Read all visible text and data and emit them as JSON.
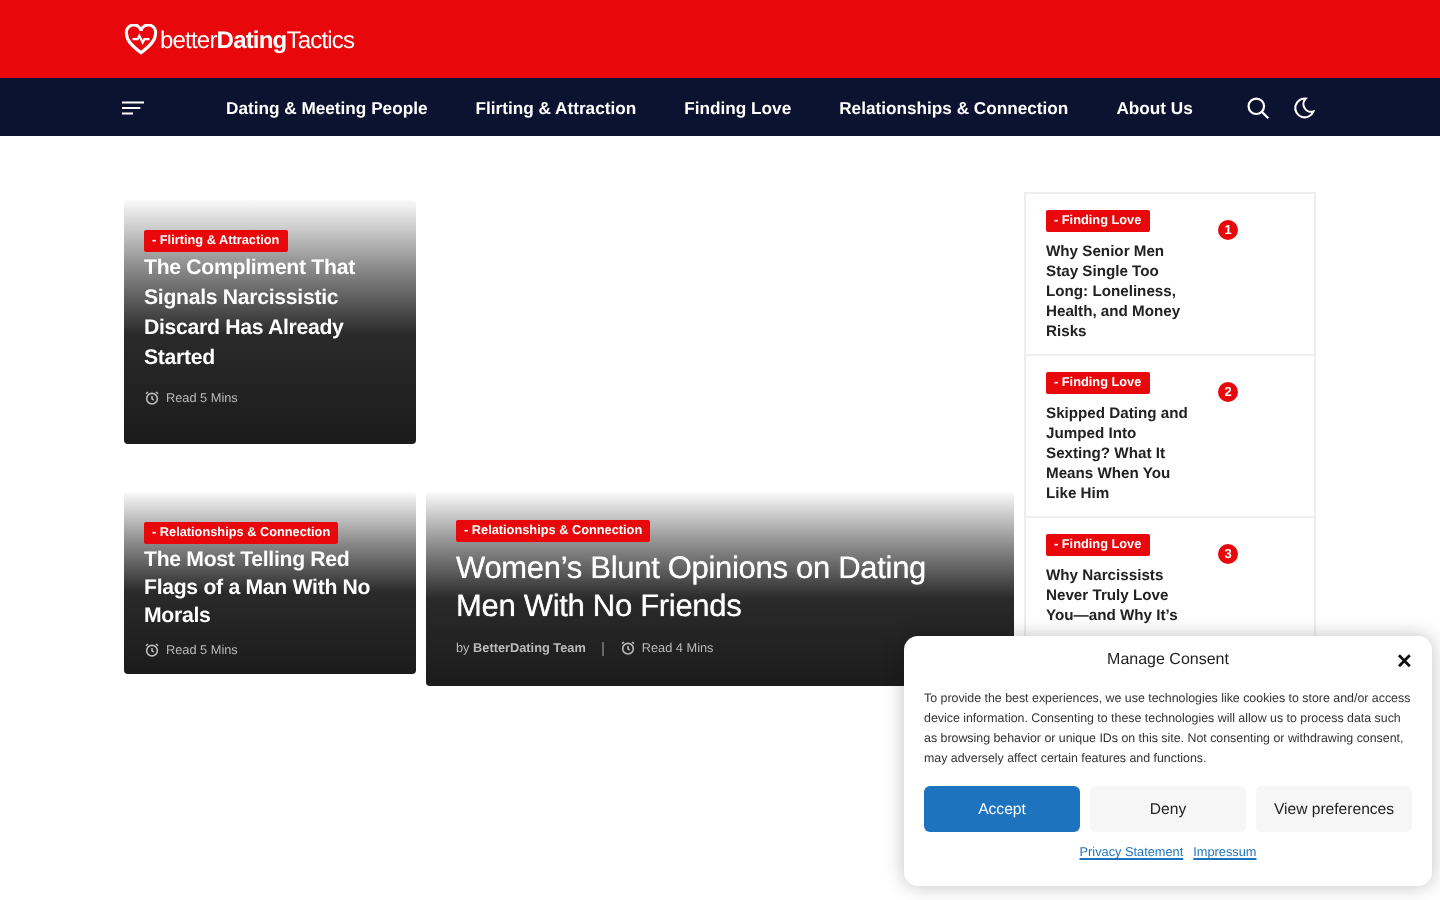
{
  "header": {
    "logo": "better**Dating**Tactics"
  },
  "nav": {
    "items": [
      {
        "label": "Dating & Meeting People"
      },
      {
        "label": "Flirting & Attraction"
      },
      {
        "label": "Finding Love"
      },
      {
        "label": "Relationships & Connection"
      },
      {
        "label": "About Us"
      }
    ]
  },
  "posts": [
    {
      "kind": "small",
      "category": "- Flirting & Attraction",
      "title": "The Compliment That Signals Narcissistic Discard Has Already Started",
      "read_time": "Read 5 Mins"
    },
    {
      "kind": "small",
      "category": "- Relationships & Connection",
      "title": "The Most Telling Red Flags of a Man With No Morals",
      "read_time": "Read 5 Mins"
    },
    {
      "kind": "large",
      "category": "- Relationships & Connection",
      "title": "Women’s Blunt Opinions on Dating Men With No Friends",
      "byline": "by **BetterDating Team**",
      "read_time": "Read 4 Mins"
    }
  ],
  "sidebar": {
    "items": [
      {
        "category": "- Finding Love",
        "title": "Why Senior Men Stay Single Too Long: Loneliness, Health, and Money Risks",
        "rank": "1"
      },
      {
        "category": "- Finding Love",
        "title": "Skipped Dating and Jumped Into Sexting? What It Means When You Like Him",
        "rank": "2"
      },
      {
        "category": "- Finding Love",
        "title": "Why Narcissists Never Truly Love You—and Why It’s",
        "rank": "3"
      }
    ]
  },
  "consent": {
    "title": "Manage Consent",
    "close": "✕",
    "text": "To provide the best experiences, we use technologies like cookies to store and/or access device information. Consenting to these technologies will allow us to process data such as browsing behavior or unique IDs on this site. Not consenting or withdrawing consent, may adversely affect certain features and functions.",
    "buttons": [
      {
        "label": "Accept",
        "kind": "primary"
      },
      {
        "label": "Deny",
        "kind": "secondary"
      },
      {
        "label": "View preferences",
        "kind": "secondary"
      }
    ],
    "links": [
      "Privacy Statement",
      "Impressum"
    ]
  }
}
